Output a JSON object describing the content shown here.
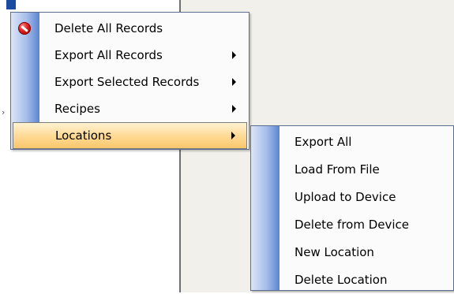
{
  "context_menu": {
    "items": [
      {
        "label": "Delete All Records",
        "icon": "delete-icon",
        "has_submenu": false,
        "highlighted": false
      },
      {
        "label": "Export All Records",
        "has_submenu": true,
        "highlighted": false
      },
      {
        "label": "Export Selected Records",
        "has_submenu": true,
        "highlighted": false
      },
      {
        "label": "Recipes",
        "has_submenu": true,
        "highlighted": false
      },
      {
        "label": "Locations",
        "has_submenu": true,
        "highlighted": true
      }
    ]
  },
  "submenu": {
    "items": [
      {
        "label": "Export All"
      },
      {
        "label": "Load From File"
      },
      {
        "label": "Upload to Device"
      },
      {
        "label": "Delete from Device"
      },
      {
        "label": "New Location"
      },
      {
        "label": "Delete Location"
      }
    ]
  },
  "colors": {
    "highlight": "#ffd892",
    "menu_border": "#5d6c8e",
    "gutter": "#5d84d1",
    "app_background": "#f1f0ea"
  }
}
